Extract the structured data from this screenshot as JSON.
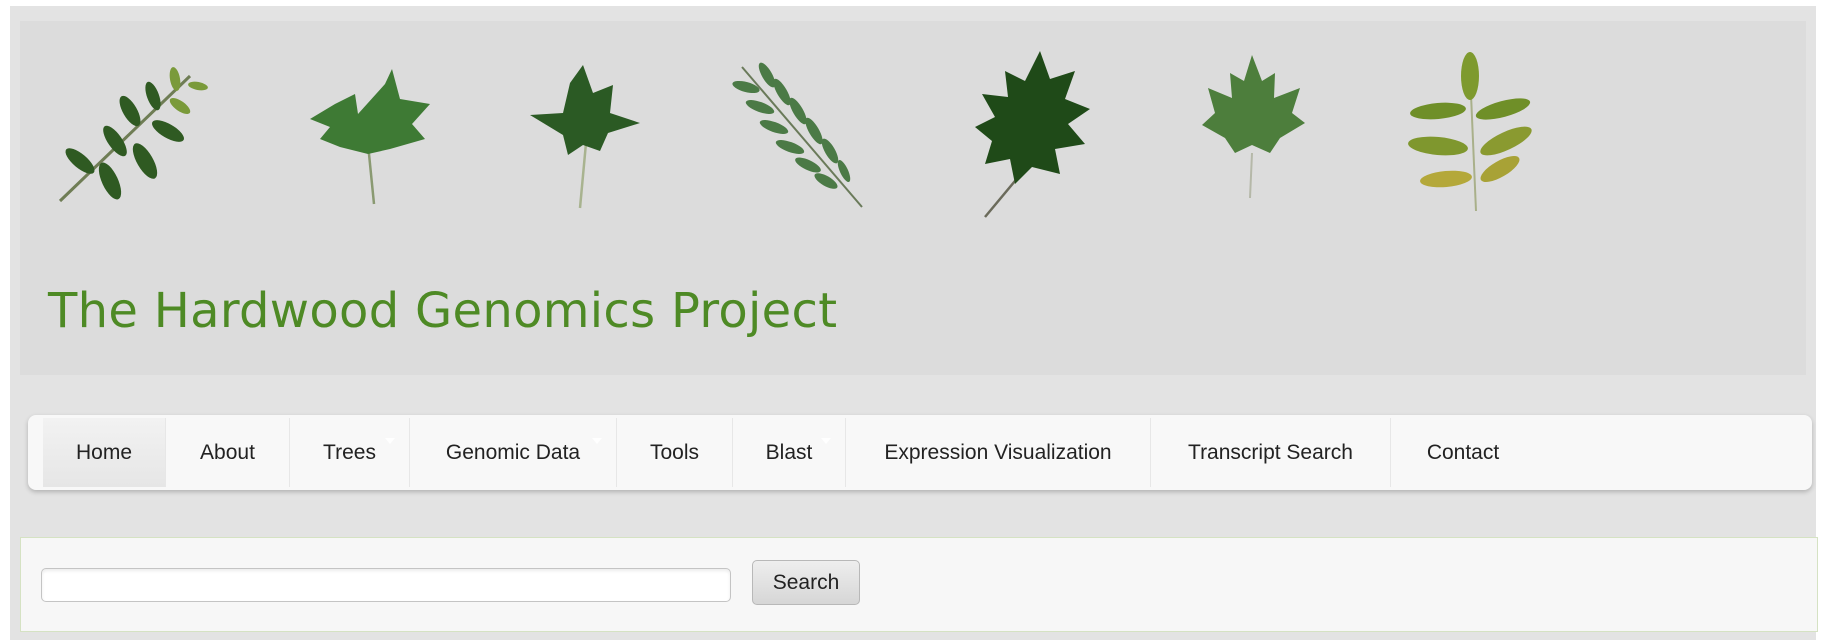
{
  "banner": {
    "title": "The Hardwood Genomics Project",
    "leaves": [
      {
        "name": "compound-leaf-icon"
      },
      {
        "name": "tulip-poplar-leaf-icon"
      },
      {
        "name": "sweetgum-leaf-icon"
      },
      {
        "name": "black-locust-leaf-icon"
      },
      {
        "name": "red-oak-leaf-icon"
      },
      {
        "name": "maple-leaf-icon"
      },
      {
        "name": "ash-leaf-icon"
      }
    ]
  },
  "nav": {
    "items": [
      {
        "label": "Home",
        "active": true
      },
      {
        "label": "About"
      },
      {
        "label": "Trees",
        "dropdown": true
      },
      {
        "label": "Genomic Data",
        "dropdown": true
      },
      {
        "label": "Tools"
      },
      {
        "label": "Blast",
        "dropdown": true
      },
      {
        "label": "Expression Visualization"
      },
      {
        "label": "Transcript Search"
      },
      {
        "label": "Contact"
      }
    ]
  },
  "search": {
    "value": "",
    "button_label": "Search"
  },
  "colors": {
    "title_green": "#4e8a25",
    "banner_bg": "#dcdcdc",
    "page_bg": "#e3e3e3",
    "nav_bg": "#f8f8f8"
  }
}
